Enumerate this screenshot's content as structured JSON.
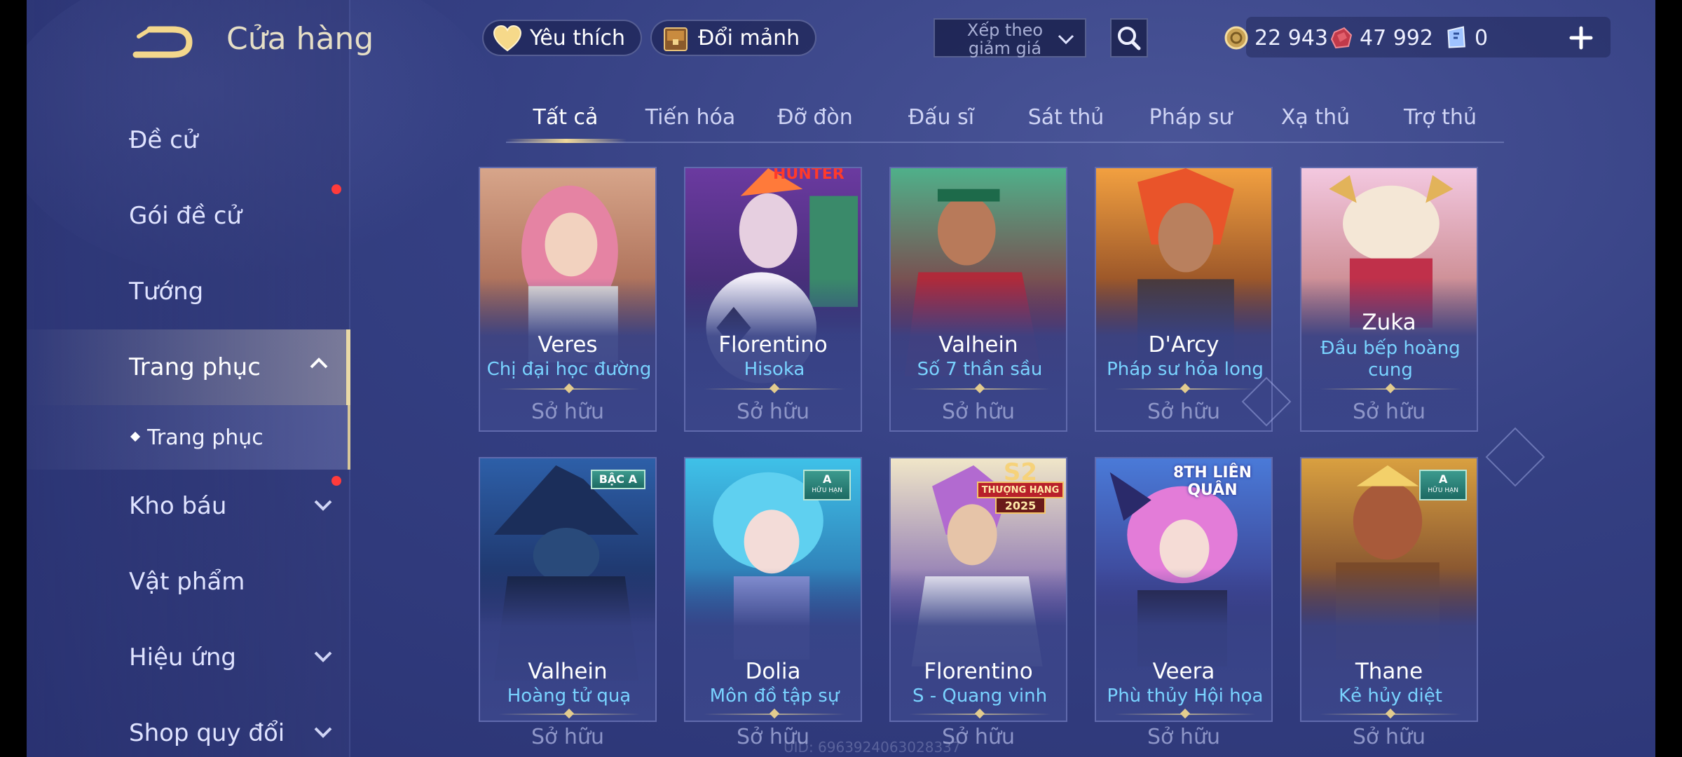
{
  "header": {
    "title": "Cửa hàng"
  },
  "nav": {
    "items": [
      {
        "label": "Đề cử"
      },
      {
        "label": "Gói đề cử"
      },
      {
        "label": "Tướng"
      },
      {
        "label": "Trang phục"
      },
      {
        "label": "Kho báu"
      },
      {
        "label": "Vật phẩm"
      },
      {
        "label": "Hiệu ứng"
      },
      {
        "label": "Shop quy đổi"
      }
    ],
    "sub_item": {
      "label": "Trang phục"
    }
  },
  "toolbar": {
    "favorites_label": "Yêu thích",
    "exchange_label": "Đổi mảnh",
    "sort_label": "Xếp theo giảm giá"
  },
  "currencies": [
    {
      "icon": "gold-coin-icon",
      "value": "22 943"
    },
    {
      "icon": "ruby-icon",
      "value": "47 992"
    },
    {
      "icon": "voucher-icon",
      "value": "0"
    }
  ],
  "tabs": [
    "Tất cả",
    "Tiến hóa",
    "Đỡ đòn",
    "Đấu sĩ",
    "Sát thủ",
    "Pháp sư",
    "Xạ thủ",
    "Trợ thủ"
  ],
  "cards": [
    {
      "hero": "Veres",
      "skin": "Chị đại học đường",
      "status": "Sở hữu"
    },
    {
      "hero": "Florentino",
      "skin": "Hisoka",
      "status": "Sở hữu",
      "art_text": "HUNTER"
    },
    {
      "hero": "Valhein",
      "skin": "Số 7 thần sầu",
      "status": "Sở hữu"
    },
    {
      "hero": "D'Arcy",
      "skin": "Pháp sư hỏa long",
      "status": "Sở hữu"
    },
    {
      "hero": "Zuka",
      "skin": "Đầu bếp hoàng cung",
      "status": "Sở hữu"
    },
    {
      "hero": "Valhein",
      "skin": "Hoàng tử quạ",
      "status": "Sở hữu",
      "badge": "BẬC A"
    },
    {
      "hero": "Dolia",
      "skin": "Môn đồ tập sự",
      "status": "Sở hữu",
      "badge": "A",
      "badge_sub": "HỮU HẠN"
    },
    {
      "hero": "Florentino",
      "skin": "S - Quang vinh",
      "status": "Sở hữu",
      "badge": "S2",
      "badge_sub": "THƯỢNG HẠNG",
      "badge_year": "2025"
    },
    {
      "hero": "Veera",
      "skin": "Phù thủy Hội họa",
      "status": "Sở hữu",
      "badge": "8TH LIÊN QUÂN"
    },
    {
      "hero": "Thane",
      "skin": "Kẻ hủy diệt",
      "status": "Sở hữu",
      "badge": "A",
      "badge_sub": "HỮU HẠN"
    }
  ],
  "footer": {
    "uid": "UID: 6963924063028337"
  },
  "colors": {
    "accent_gold": "#f0d99a",
    "skin_name": "#79d3ff",
    "bg": "#343f82",
    "red_dot": "#ff3b3b"
  }
}
